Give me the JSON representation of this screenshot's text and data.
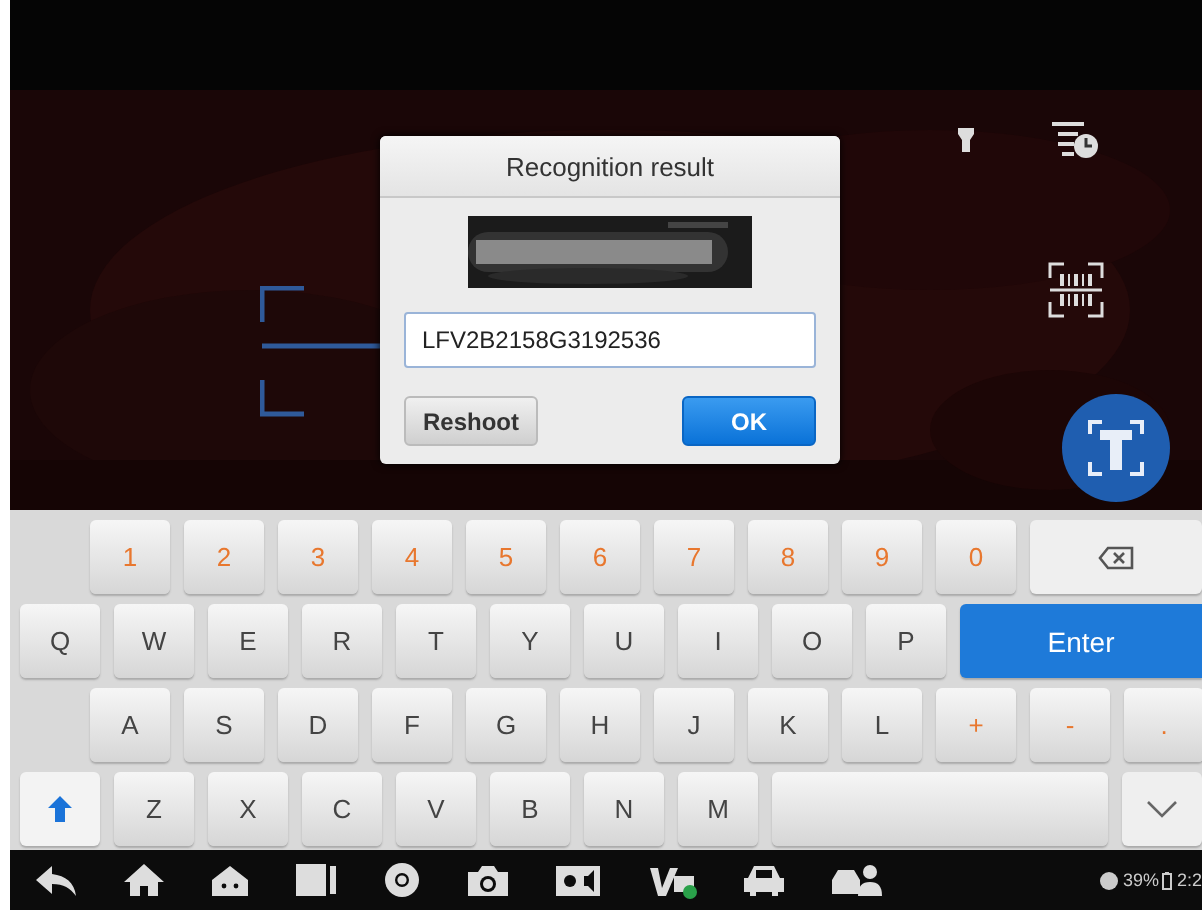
{
  "dialog": {
    "title": "Recognition result",
    "vin_value": "LFV2B2158G3192536",
    "buttons": [
      {
        "label": "Reshoot",
        "kind": "secondary"
      },
      {
        "label": "OK",
        "kind": "primary"
      }
    ]
  },
  "keyboard": {
    "rows": [
      [
        {
          "kind": "symbol",
          "label": "1"
        },
        {
          "kind": "symbol",
          "label": "2"
        },
        {
          "kind": "symbol",
          "label": "3"
        },
        {
          "kind": "symbol",
          "label": "4"
        },
        {
          "kind": "symbol",
          "label": "5"
        },
        {
          "kind": "symbol",
          "label": "6"
        },
        {
          "kind": "symbol",
          "label": "7"
        },
        {
          "kind": "symbol",
          "label": "8"
        },
        {
          "kind": "symbol",
          "label": "9"
        },
        {
          "kind": "symbol",
          "label": "0"
        },
        {
          "kind": "backspace"
        }
      ],
      [
        {
          "kind": "letter",
          "label": "Q"
        },
        {
          "kind": "letter",
          "label": "W"
        },
        {
          "kind": "letter",
          "label": "E"
        },
        {
          "kind": "letter",
          "label": "R"
        },
        {
          "kind": "letter",
          "label": "T"
        },
        {
          "kind": "letter",
          "label": "Y"
        },
        {
          "kind": "letter",
          "label": "U"
        },
        {
          "kind": "letter",
          "label": "I"
        },
        {
          "kind": "letter",
          "label": "O"
        },
        {
          "kind": "letter",
          "label": "P"
        },
        {
          "kind": "enter",
          "label": "Enter"
        }
      ],
      [
        {
          "kind": "letter",
          "label": "A"
        },
        {
          "kind": "letter",
          "label": "S"
        },
        {
          "kind": "letter",
          "label": "D"
        },
        {
          "kind": "letter",
          "label": "F"
        },
        {
          "kind": "letter",
          "label": "G"
        },
        {
          "kind": "letter",
          "label": "H"
        },
        {
          "kind": "letter",
          "label": "J"
        },
        {
          "kind": "letter",
          "label": "K"
        },
        {
          "kind": "letter",
          "label": "L"
        },
        {
          "kind": "symbol",
          "label": "+"
        },
        {
          "kind": "symbol",
          "label": "-"
        },
        {
          "kind": "symbol",
          "label": "."
        }
      ],
      [
        {
          "kind": "shift"
        },
        {
          "kind": "letter",
          "label": "Z"
        },
        {
          "kind": "letter",
          "label": "X"
        },
        {
          "kind": "letter",
          "label": "C"
        },
        {
          "kind": "letter",
          "label": "V"
        },
        {
          "kind": "letter",
          "label": "B"
        },
        {
          "kind": "letter",
          "label": "N"
        },
        {
          "kind": "letter",
          "label": "M"
        },
        {
          "kind": "space"
        },
        {
          "kind": "hide"
        }
      ]
    ]
  },
  "nav_bar": {
    "battery": "39%",
    "time": "2:2"
  }
}
